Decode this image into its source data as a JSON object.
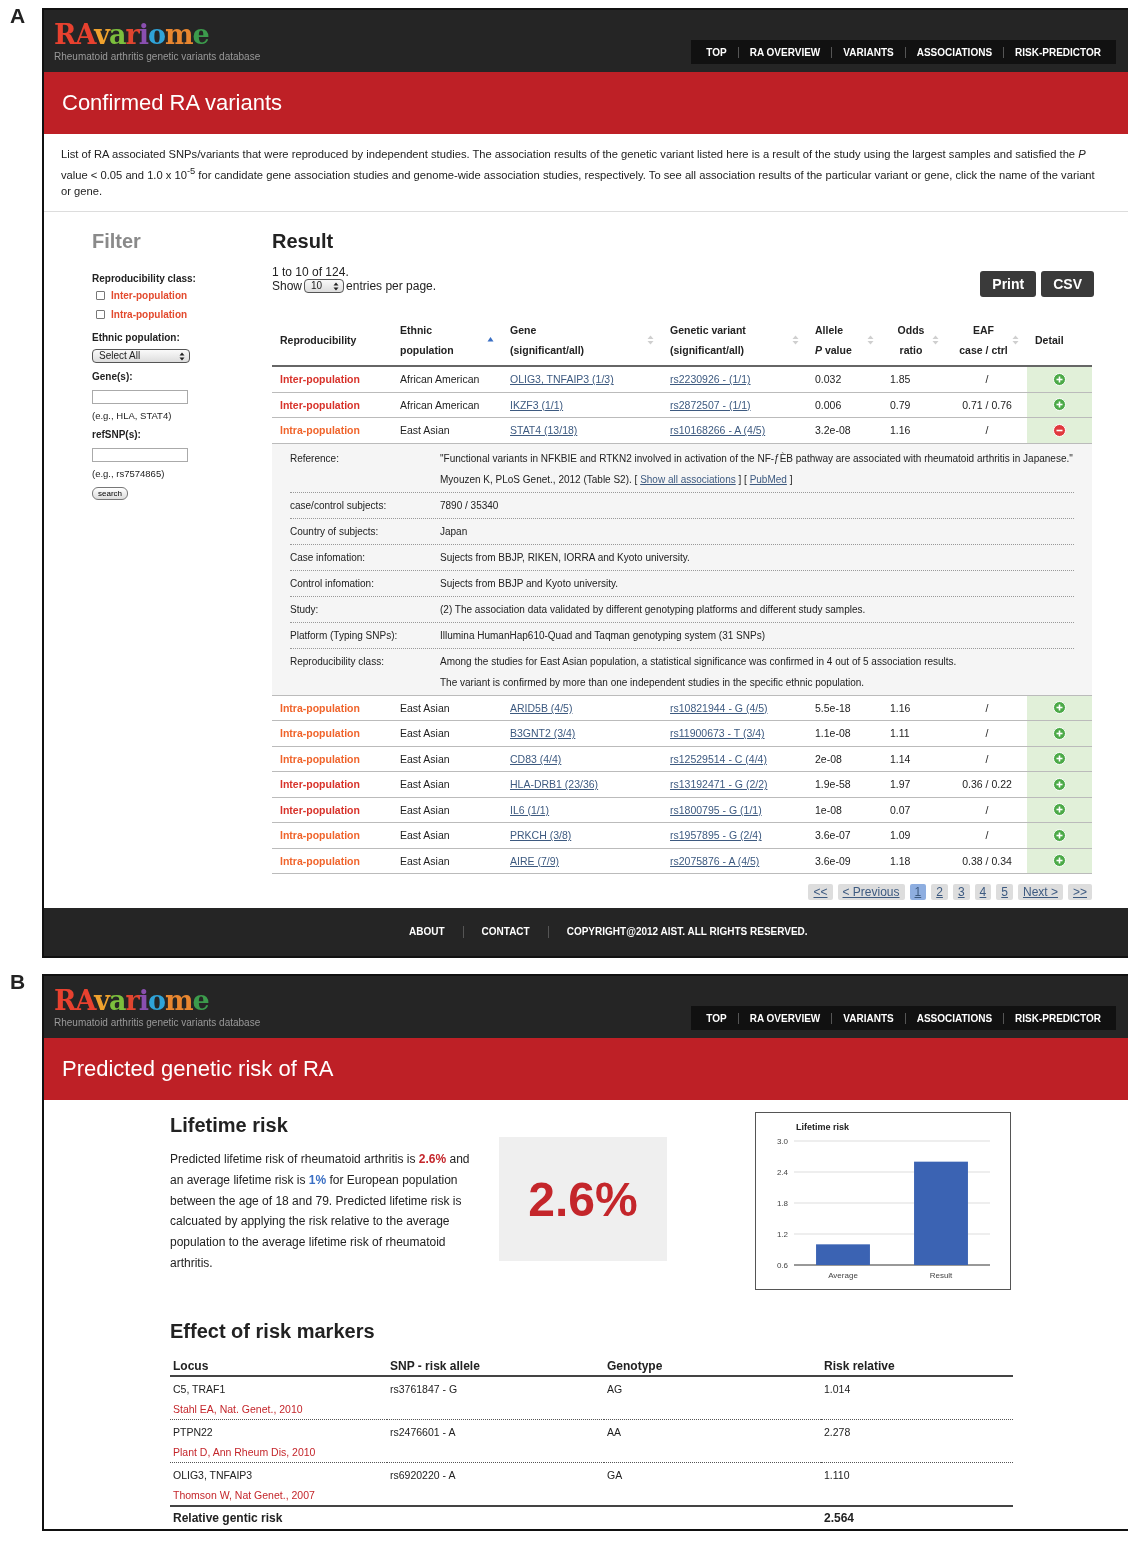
{
  "panel_a": {
    "label": "A",
    "header": {
      "logo": "RAvariome",
      "tagline": "Rheumatoid arthritis genetic variants database",
      "nav": [
        "TOP",
        "RA OVERVIEW",
        "VARIANTS",
        "ASSOCIATIONS",
        "RISK-PREDICTOR"
      ]
    },
    "page_title": "Confirmed RA variants",
    "description": "List of RA associated SNPs/variants that were reproduced by independent studies. The association results of the genetic variant listed here is a result of the study using the largest samples and satisfied the *P* value < 0.05 and 1.0 x 10$^{-5}$ for candidate gene association studies and genome-wide association studies, respectively. To see all association results of the particular variant or gene, click the name of the variant or gene.",
    "filter": {
      "title": "Filter",
      "reproducibility_label": "Reproducibility class:",
      "checkboxes": [
        {
          "label": "Inter-population",
          "checked": false
        },
        {
          "label": "Intra-population",
          "checked": false
        }
      ],
      "ethnic_label": "Ethnic population:",
      "ethnic_select": "Select All",
      "gene_label": "Gene(s):",
      "gene_hint": "(e.g., HLA, STAT4)",
      "refsnp_label": "refSNP(s):",
      "refsnp_hint": "(e.g., rs7574865)",
      "search_button": "search"
    },
    "result": {
      "title": "Result",
      "count": "1 to 10 of 124.",
      "show_before": "Show",
      "page_size": "10",
      "show_after": "entries per page.",
      "buttons": [
        "Print",
        "CSV"
      ],
      "columns": [
        {
          "lines": [
            "Reproducibility"
          ],
          "kind": "plain"
        },
        {
          "lines": [
            "Ethnic",
            "population"
          ],
          "kind": "sorted"
        },
        {
          "lines": [
            "Gene",
            "(significant/all)"
          ],
          "kind": "sortable"
        },
        {
          "lines": [
            "Genetic variant",
            "(significant/all)"
          ],
          "kind": "sortable"
        },
        {
          "lines": [
            "Allele",
            "*P* value"
          ],
          "kind": "sortable"
        },
        {
          "lines": [
            "Odds",
            "ratio"
          ],
          "kind": "sortable"
        },
        {
          "lines": [
            "EAF",
            "case / ctrl"
          ],
          "kind": "sortable"
        },
        {
          "lines": [
            "Detail"
          ],
          "kind": "plain"
        }
      ],
      "rows": [
        {
          "reproducibility": "Inter-population",
          "kind": "inter",
          "ethnic": "African American",
          "gene": "OLIG3, TNFAIP3 (1/3)",
          "variant": "rs2230926 - (1/1)",
          "p_value": "0.032",
          "odds_ratio": "1.85",
          "eaf": "/",
          "expanded": false
        },
        {
          "reproducibility": "Inter-population",
          "kind": "inter",
          "ethnic": "African American",
          "gene": "IKZF3 (1/1)",
          "variant": "rs2872507 - (1/1)",
          "p_value": "0.006",
          "odds_ratio": "0.79",
          "eaf": "0.71 / 0.76",
          "expanded": false
        },
        {
          "reproducibility": "Intra-population",
          "kind": "intra",
          "ethnic": "East Asian",
          "gene": "STAT4 (13/18)",
          "variant": "rs10168266 - A (4/5)",
          "p_value": "3.2e-08",
          "odds_ratio": "1.16",
          "eaf": "/",
          "expanded": true,
          "detail": [
            {
              "label": "Reference:",
              "parts": [
                {
                  "text": "\"Functional variants in NFKBIE and RTKN2 involved in activation of the NF-ƒÈB pathway are associated with rheumatoid arthritis in Japanese.\" Myouzen K, PLoS Genet., 2012 (Table S2). [ "
                },
                {
                  "link": "Show all associations"
                },
                {
                  "text": " ] [ "
                },
                {
                  "link": "PubMed"
                },
                {
                  "text": " ]"
                }
              ]
            },
            {
              "label": "case/control subjects:",
              "parts": [
                {
                  "text": "7890 / 35340"
                }
              ]
            },
            {
              "label": "Country of subjects:",
              "parts": [
                {
                  "text": "Japan"
                }
              ]
            },
            {
              "label": "Case infomation:",
              "parts": [
                {
                  "text": "Sujects from BBJP, RIKEN, IORRA and Kyoto university."
                }
              ]
            },
            {
              "label": "Control infomation:",
              "parts": [
                {
                  "text": "Sujects from BBJP and Kyoto university."
                }
              ]
            },
            {
              "label": "Study:",
              "parts": [
                {
                  "text": "(2) The association data validated by different genotyping platforms and different study samples."
                }
              ]
            },
            {
              "label": "Platform (Typing SNPs):",
              "parts": [
                {
                  "text": "Illumina HumanHap610-Quad and Taqman genotyping system (31 SNPs)"
                }
              ]
            },
            {
              "label": "Reproducibility class:",
              "lines": [
                "Among the studies for East Asian population, a statistical significance was confirmed in 4 out of 5 association results.",
                "The variant is confirmed by more than one independent studies in the specific ethnic population."
              ]
            }
          ]
        },
        {
          "reproducibility": "Intra-population",
          "kind": "intra",
          "ethnic": "East Asian",
          "gene": "ARID5B (4/5)",
          "variant": "rs10821944 - G (4/5)",
          "p_value": "5.5e-18",
          "odds_ratio": "1.16",
          "eaf": "/",
          "expanded": false
        },
        {
          "reproducibility": "Intra-population",
          "kind": "intra",
          "ethnic": "East Asian",
          "gene": "B3GNT2 (3/4)",
          "variant": "rs11900673 - T (3/4)",
          "p_value": "1.1e-08",
          "odds_ratio": "1.11",
          "eaf": "/",
          "expanded": false
        },
        {
          "reproducibility": "Intra-population",
          "kind": "intra",
          "ethnic": "East Asian",
          "gene": "CD83 (4/4)",
          "variant": "rs12529514 - C (4/4)",
          "p_value": "2e-08",
          "odds_ratio": "1.14",
          "eaf": "/",
          "expanded": false
        },
        {
          "reproducibility": "Inter-population",
          "kind": "inter",
          "ethnic": "East Asian",
          "gene": "HLA-DRB1 (23/36)",
          "variant": "rs13192471 - G (2/2)",
          "p_value": "1.9e-58",
          "odds_ratio": "1.97",
          "eaf": "0.36 / 0.22",
          "expanded": false
        },
        {
          "reproducibility": "Inter-population",
          "kind": "inter",
          "ethnic": "East Asian",
          "gene": "IL6 (1/1)",
          "variant": "rs1800795 - G (1/1)",
          "p_value": "1e-08",
          "odds_ratio": "0.07",
          "eaf": "/",
          "expanded": false
        },
        {
          "reproducibility": "Intra-population",
          "kind": "intra",
          "ethnic": "East Asian",
          "gene": "PRKCH (3/8)",
          "variant": "rs1957895 - G (2/4)",
          "p_value": "3.6e-07",
          "odds_ratio": "1.09",
          "eaf": "/",
          "expanded": false
        },
        {
          "reproducibility": "Intra-population",
          "kind": "intra",
          "ethnic": "East Asian",
          "gene": "AIRE (7/9)",
          "variant": "rs2075876 - A (4/5)",
          "p_value": "3.6e-09",
          "odds_ratio": "1.18",
          "eaf": "0.38 / 0.34",
          "expanded": false
        }
      ],
      "pagination": [
        {
          "label": "<<",
          "selected": false
        },
        {
          "label": "< Previous",
          "selected": false
        },
        {
          "label": "1",
          "selected": true
        },
        {
          "label": "2",
          "selected": false
        },
        {
          "label": "3",
          "selected": false
        },
        {
          "label": "4",
          "selected": false
        },
        {
          "label": "5",
          "selected": false
        },
        {
          "label": "Next >",
          "selected": false
        },
        {
          "label": ">>",
          "selected": false
        }
      ]
    },
    "footer": {
      "links": [
        "ABOUT",
        "CONTACT"
      ],
      "copyright": "COPYRIGHT@2012 AIST. ALL RIGHTS RESERVED."
    }
  },
  "panel_b": {
    "label": "B",
    "header": {
      "logo": "RAvariome",
      "tagline": "Rheumatoid arthritis genetic variants database",
      "nav": [
        "TOP",
        "RA OVERVIEW",
        "VARIANTS",
        "ASSOCIATIONS",
        "RISK-PREDICTOR"
      ]
    },
    "page_title": "Predicted genetic risk of RA",
    "lifetime": {
      "heading": "Lifetime risk",
      "parts": [
        {
          "text": "Predicted lifetime risk of rheumatoid arthritis is "
        },
        {
          "text": "2.6%",
          "kind": "result"
        },
        {
          "text": " and an average lifetime risk is "
        },
        {
          "text": "1%",
          "kind": "average"
        },
        {
          "text": " for European population between the age of 18 and 79. Predicted lifetime risk is calcuated by applying the risk relative to the average population to the average lifetime risk of rheumatoid arthritis."
        }
      ],
      "big_value": "2.6%",
      "chart_data": {
        "type": "bar",
        "title": "Lifetime risk",
        "categories": [
          "Average",
          "Result"
        ],
        "values": [
          1.0,
          2.6
        ],
        "ylim": [
          0.6,
          3.0
        ],
        "grid": true,
        "yticks": [
          {
            "value": 0.6,
            "label": "0.6"
          },
          {
            "value": 1.2,
            "label": "1.2"
          },
          {
            "value": 1.8,
            "label": "1.8"
          },
          {
            "value": 2.4,
            "label": "2.4"
          },
          {
            "value": 3.0,
            "label": "3.0"
          }
        ]
      }
    },
    "effect": {
      "heading": "Effect of risk markers",
      "columns": [
        "Locus",
        "SNP - risk allele",
        "Genotype",
        "Risk relative"
      ],
      "rows": [
        {
          "locus": "C5, TRAF1",
          "reference": "Stahl EA, Nat. Genet., 2010",
          "snp": "rs3761847 - G",
          "genotype": "AG",
          "risk": "1.014"
        },
        {
          "locus": "PTPN22",
          "reference": "Plant D, Ann Rheum Dis, 2010",
          "snp": "rs2476601 - A",
          "genotype": "AA",
          "risk": "2.278"
        },
        {
          "locus": "OLIG3, TNFAIP3",
          "reference": "Thomson W, Nat Genet., 2007",
          "snp": "rs6920220 - A",
          "genotype": "GA",
          "risk": "1.110"
        }
      ],
      "total_label": "Relative gentic risk",
      "total_value": "2.564"
    }
  }
}
